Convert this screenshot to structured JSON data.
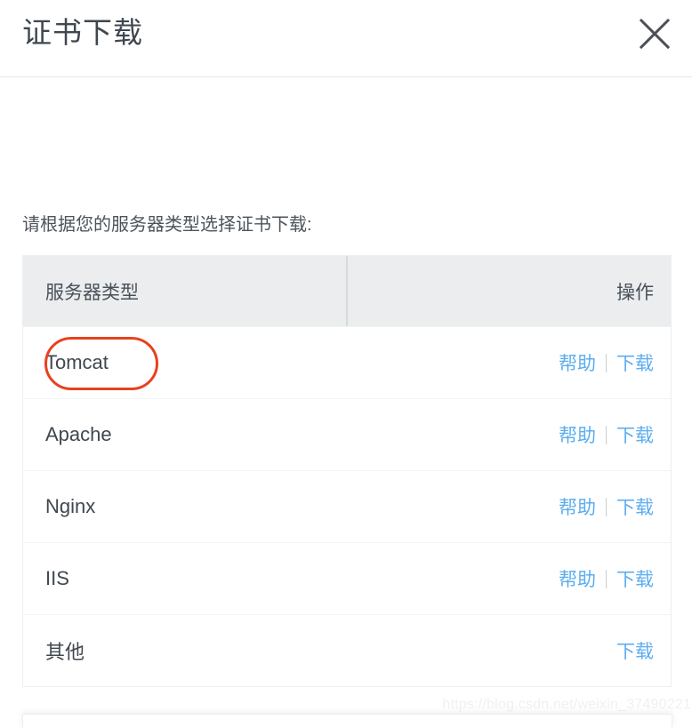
{
  "dialog": {
    "title": "证书下载",
    "close_icon": "close-icon",
    "instruction": "请根据您的服务器类型选择证书下载:"
  },
  "table": {
    "headers": {
      "server_type": "服务器类型",
      "action": "操作"
    },
    "rows": [
      {
        "server": "Tomcat",
        "help_label": "帮助",
        "download_label": "下载",
        "has_help": true,
        "highlighted": true
      },
      {
        "server": "Apache",
        "help_label": "帮助",
        "download_label": "下载",
        "has_help": true,
        "highlighted": false
      },
      {
        "server": "Nginx",
        "help_label": "帮助",
        "download_label": "下载",
        "has_help": true,
        "highlighted": false
      },
      {
        "server": "IIS",
        "help_label": "帮助",
        "download_label": "下载",
        "has_help": true,
        "highlighted": false
      },
      {
        "server": "其他",
        "help_label": "",
        "download_label": "下载",
        "has_help": false,
        "highlighted": false
      }
    ]
  },
  "watermark": {
    "text": "https://blog.csdn.net/weixin_37490221"
  },
  "colors": {
    "link_blue": "#5cadef",
    "annotation_red": "#e8411d",
    "header_bg": "#ebedee",
    "text_dark": "#3f474f"
  }
}
